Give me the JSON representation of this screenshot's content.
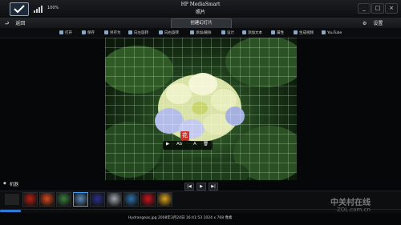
{
  "window": {
    "app_title": "HP MediaSmart",
    "photo_title": "照片",
    "battery_text": "100%",
    "minimize": "_",
    "maximize": "□",
    "close": "×"
  },
  "nav": {
    "back_label": "返回",
    "create_tab": "创建幻灯片",
    "settings_label": "设置"
  },
  "toolbar": {
    "items": [
      "打开",
      "保存",
      "另存为",
      "向左旋转",
      "向右旋转",
      "添加/删除",
      "设计",
      "添加文本",
      "属性",
      "生成视频",
      "YouTube"
    ]
  },
  "photo": {
    "badge": "花",
    "overlay": {
      "play": "▶",
      "text1": "Ab",
      "text2": "A",
      "delete": "🗑"
    }
  },
  "playback": {
    "prev": "|◀",
    "play": "▶",
    "next": "▶|"
  },
  "filmstrip": {
    "label": "机器",
    "arrow": "◆",
    "thumbs": [
      {
        "color": "#b32214"
      },
      {
        "color": "#d84a1f"
      },
      {
        "color": "#3a7d3d"
      },
      {
        "color": "#5b88b8"
      },
      {
        "color": "#2a2f8a"
      },
      {
        "color": "#9fa6ae"
      },
      {
        "color": "#2f6fa8"
      },
      {
        "color": "#c9141e"
      },
      {
        "color": "#d8a31f"
      }
    ]
  },
  "status": "Hydrangeas.jpg    2008年3月24日 16:41:53    1024 x 768 像素",
  "watermark": {
    "line1": "中关村在线",
    "line2": "ZOL.com.cn"
  },
  "colors": {
    "accent": "#2f7ad8",
    "background": "#060708"
  }
}
